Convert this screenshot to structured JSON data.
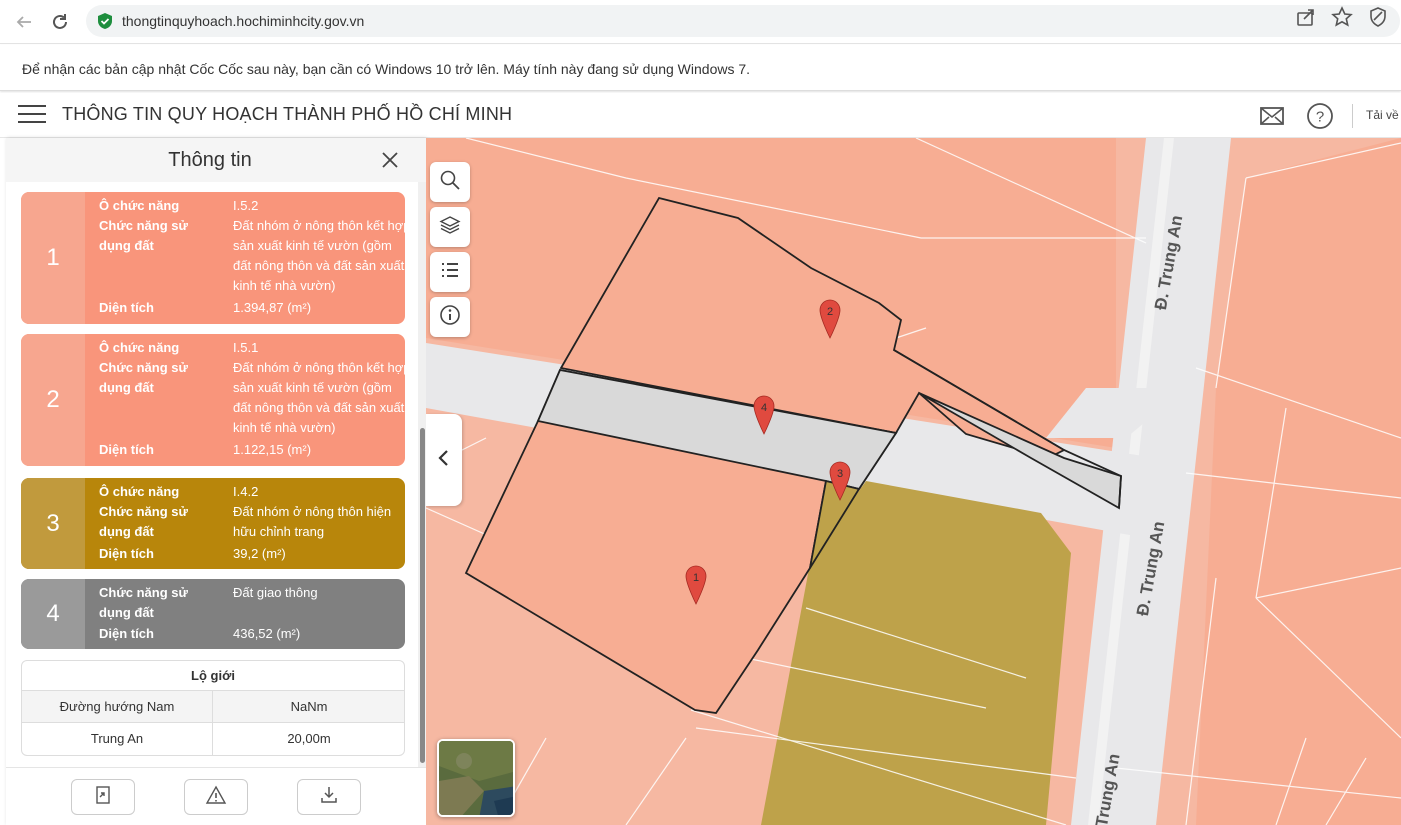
{
  "browser": {
    "url": "thongtinquyhoach.hochiminhcity.gov.vn"
  },
  "notice": {
    "text": "Để nhận các bản cập nhật Cốc Cốc sau này, bạn cần có Windows 10 trở lên. Máy tính này đang sử dụng Windows 7."
  },
  "header": {
    "title": "THÔNG TIN QUY HOẠCH THÀNH PHỐ HỒ CHÍ MINH",
    "more": "Tải về"
  },
  "panel": {
    "title": "Thông tin",
    "cards": [
      {
        "num": "1",
        "code_label": "Ô chức năng",
        "code": "I.5.2",
        "func_label": "Chức năng sử dụng đất",
        "func": "Đất nhóm ở nông thôn kết hợp sản xuất kinh tế vườn (gồm đất nông thôn và đất sản xuất kinh tế nhà vườn)",
        "area_label": "Diện tích",
        "area": "1.394,87 (m²)"
      },
      {
        "num": "2",
        "code_label": "Ô chức năng",
        "code": "I.5.1",
        "func_label": "Chức năng sử dụng đất",
        "func": "Đất nhóm ở nông thôn kết hợp sản xuất kinh tế vườn (gồm đất nông thôn và đất sản xuất kinh tế nhà vườn)",
        "area_label": "Diện tích",
        "area": "1.122,15 (m²)"
      },
      {
        "num": "3",
        "code_label": "Ô chức năng",
        "code": "I.4.2",
        "func_label": "Chức năng sử dụng đất",
        "func": "Đất nhóm ở nông thôn hiện hữu chỉnh trang",
        "area_label": "Diện tích",
        "area": "39,2 (m²)"
      },
      {
        "num": "4",
        "func_label": "Chức năng sử dụng đất",
        "func": "Đất giao thông",
        "area_label": "Diện tích",
        "area": "436,52 (m²)"
      }
    ],
    "lo_gioi": {
      "title": "Lộ giới",
      "headers": [
        "Đường hướng Nam",
        "NaNm"
      ],
      "rows": [
        [
          "Trung An",
          "20,00m"
        ]
      ]
    }
  },
  "map": {
    "markers": [
      "1",
      "2",
      "3",
      "4"
    ],
    "road_labels": [
      "Đ. Trung An",
      "Đ. Trung An",
      "Trung An"
    ],
    "colors": {
      "residential": "#f6b8a2",
      "residential_dark": "#f7ad93",
      "existing_residential": "#bea24a",
      "road": "#e8e8ea",
      "marker": "#e04a3f"
    }
  },
  "icons": {
    "back": "arrow-left-icon",
    "reload": "reload-icon",
    "secure": "shield-check-icon",
    "share": "share-icon",
    "star": "star-icon",
    "shield": "shield-icon",
    "menu": "hamburger-icon",
    "mail": "mail-icon",
    "help": "help-icon",
    "close": "close-icon",
    "search": "search-icon",
    "layers": "layers-icon",
    "list": "list-icon",
    "info": "info-icon",
    "collapse": "chevron-left-icon",
    "export": "export-document-icon",
    "warning": "warning-icon",
    "download": "download-icon"
  }
}
